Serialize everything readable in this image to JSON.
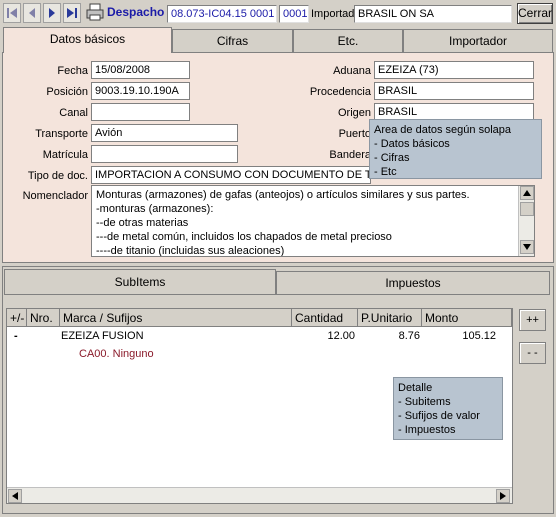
{
  "toolbar": {
    "despacho_label": "Despacho",
    "despacho_number": "08.073-IC04.15 0001",
    "code": "0001",
    "importador_label": "Importad",
    "importador_value": "BRASIL   ON SA",
    "close_label": "Cerrar"
  },
  "upper_tabs": [
    "Datos básicos",
    "Cifras",
    "Etc.",
    "Importador"
  ],
  "fields": {
    "fecha_label": "Fecha",
    "fecha": "15/08/2008",
    "posicion_label": "Posición",
    "posicion": "9003.19.10.190A",
    "canal_label": "Canal",
    "canal": "",
    "transporte_label": "Transporte",
    "transporte": "Avión",
    "matricula_label": "Matrícula",
    "matricula": "",
    "tipodoc_label": "Tipo de doc.",
    "tipodoc": "IMPORTACION A CONSUMO CON DOCUMENTO DE TRAN",
    "aduana_label": "Aduana",
    "aduana": "EZEIZA (73)",
    "procedencia_label": "Procedencia",
    "procedencia": "BRASIL",
    "origen_label": "Origen",
    "origen": "BRASIL",
    "puerto_label": "Puerto",
    "bandera_label": "Bandera",
    "nomenclador_label": "Nomenclador"
  },
  "nomenclador_lines": [
    "Monturas (armazones) de gafas (anteojos) o artículos similares y sus partes.",
    "-monturas (armazones):",
    "--de otras materias",
    "---de metal común, incluidos los chapados de metal precioso",
    "----de titanio (incluidas sus aleaciones)"
  ],
  "tooltip_top": [
    "Area de datos según solapa",
    "- Datos básicos",
    "- Cifras",
    "- Etc"
  ],
  "lower_tabs": [
    "SubItems",
    "Impuestos"
  ],
  "grid": {
    "headers": [
      "+/-",
      "Nro.",
      "Marca / Sufijos",
      "Cantidad",
      "P.Unitario",
      "Monto"
    ],
    "row": {
      "toggle": "-",
      "marca": "EZEIZA FUSION",
      "cantidad": "12.00",
      "unitario": "8.76",
      "monto": "105.12"
    },
    "subrow": "CA00. Ninguno"
  },
  "tooltip_bottom": [
    "Detalle",
    "- Subitems",
    "- Sufijos de valor",
    "- Impuestos"
  ],
  "side_buttons": {
    "expand": "++",
    "collapse": "- -"
  }
}
